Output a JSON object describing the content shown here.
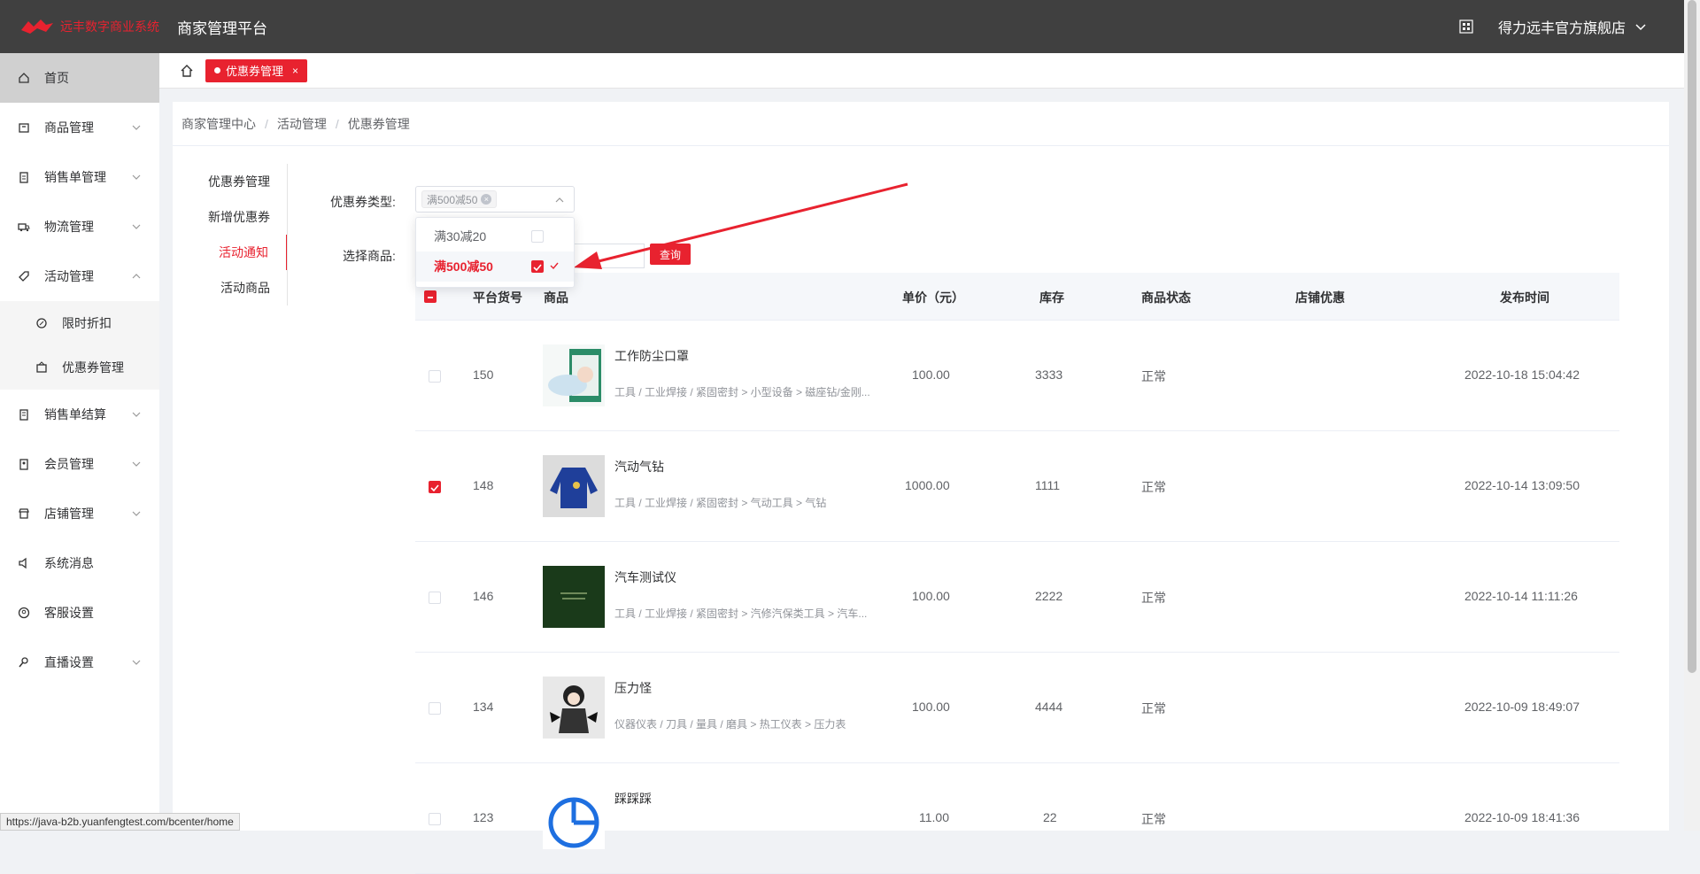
{
  "header": {
    "logo_text": "远丰数字商业系统",
    "platform_title": "商家管理平台",
    "store_name": "得力远丰官方旗舰店"
  },
  "sidebar": {
    "items": [
      {
        "label": "首页",
        "icon": "home-icon"
      },
      {
        "label": "商品管理",
        "icon": "goods-icon"
      },
      {
        "label": "销售单管理",
        "icon": "order-icon"
      },
      {
        "label": "物流管理",
        "icon": "truck-icon"
      },
      {
        "label": "活动管理",
        "icon": "tag-icon"
      },
      {
        "label": "限时折扣",
        "icon": "discount-icon"
      },
      {
        "label": "优惠券管理",
        "icon": "coupon-icon"
      },
      {
        "label": "销售单结算",
        "icon": "settle-icon"
      },
      {
        "label": "会员管理",
        "icon": "member-icon"
      },
      {
        "label": "店铺管理",
        "icon": "shop-icon"
      },
      {
        "label": "系统消息",
        "icon": "speaker-icon"
      },
      {
        "label": "客服设置",
        "icon": "service-icon"
      },
      {
        "label": "直播设置",
        "icon": "live-icon"
      }
    ]
  },
  "tabs": {
    "active_label": "优惠券管理",
    "close": "×"
  },
  "breadcrumb": [
    "商家管理中心",
    "活动管理",
    "优惠券管理"
  ],
  "subnav": [
    "优惠券管理",
    "新增优惠券",
    "活动通知",
    "活动商品"
  ],
  "form": {
    "coupon_type_label": "优惠券类型:",
    "selected_tag": "满500减50",
    "goods_label": "选择商品:",
    "query_button": "查询",
    "options": [
      "满30减20",
      "满500减50"
    ]
  },
  "table": {
    "headers": [
      "平台货号",
      "商品",
      "单价（元）",
      "库存",
      "商品状态",
      "店铺优惠",
      "发布时间"
    ],
    "rows": [
      {
        "sku": "150",
        "name": "工作防尘口罩",
        "category": "工具 / 工业焊接 / 紧固密封 > 小型设备 > 磁座钻/金刚...",
        "price": "100.00",
        "stock": "3333",
        "status": "正常",
        "time": "2022-10-18 15:04:42",
        "checked": false
      },
      {
        "sku": "148",
        "name": "汽动气钻",
        "category": "工具 / 工业焊接 / 紧固密封 > 气动工具 > 气钻",
        "price": "1000.00",
        "stock": "1111",
        "status": "正常",
        "time": "2022-10-14 13:09:50",
        "checked": true
      },
      {
        "sku": "146",
        "name": "汽车测试仪",
        "category": "工具 / 工业焊接 / 紧固密封 > 汽修汽保类工具 > 汽车...",
        "price": "100.00",
        "stock": "2222",
        "status": "正常",
        "time": "2022-10-14 11:11:26",
        "checked": false
      },
      {
        "sku": "134",
        "name": "压力怪",
        "category": "仪器仪表 / 刀具 / 量具 / 磨具 > 热工仪表 > 压力表",
        "price": "100.00",
        "stock": "4444",
        "status": "正常",
        "time": "2022-10-09 18:49:07",
        "checked": false
      },
      {
        "sku": "123",
        "name": "踩踩踩",
        "category": "",
        "price": "11.00",
        "stock": "22",
        "status": "正常",
        "time": "2022-10-09 18:41:36",
        "checked": false
      }
    ]
  },
  "status_url": "https://java-b2b.yuanfengtest.com/bcenter/home",
  "colors": {
    "accent": "#e8222f",
    "topbar": "#404040"
  }
}
